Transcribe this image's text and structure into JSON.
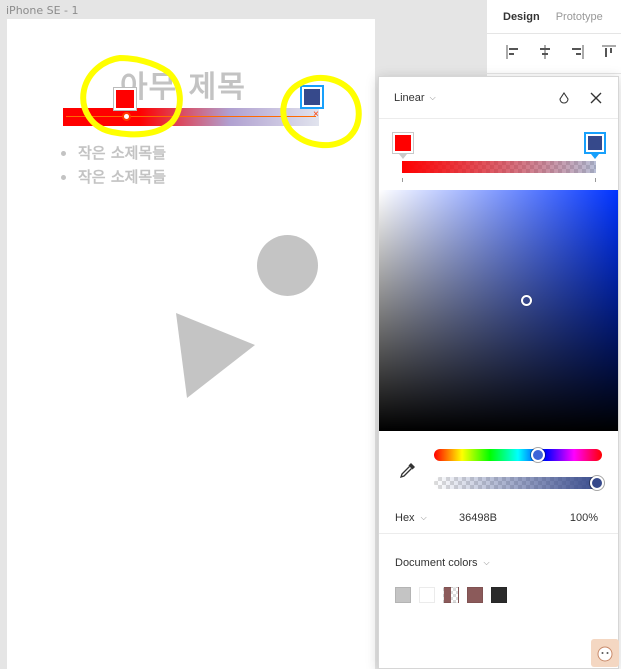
{
  "canvas": {
    "frame_label": "iPhone SE - 1",
    "title": "아무 제목",
    "bullets": [
      "작은 소제목들",
      "작은 소제목들"
    ]
  },
  "design_panel": {
    "tabs": [
      "Design",
      "Prototype"
    ]
  },
  "picker": {
    "fill_type": "Linear",
    "color_mode": "Hex",
    "hex": "36498B",
    "opacity": "100%",
    "document_colors_label": "Document colors",
    "stop_colors": [
      "#ff0000",
      "#36498b"
    ],
    "document_colors": [
      "#c4c4c4",
      "#ffffff",
      "#8b5a5a",
      "#8b5a5a",
      "#2b2b2b"
    ]
  },
  "colors": {
    "accent": "#18a0fb",
    "annotation": "#ffff00",
    "shape_gray": "#c4c4c4"
  }
}
